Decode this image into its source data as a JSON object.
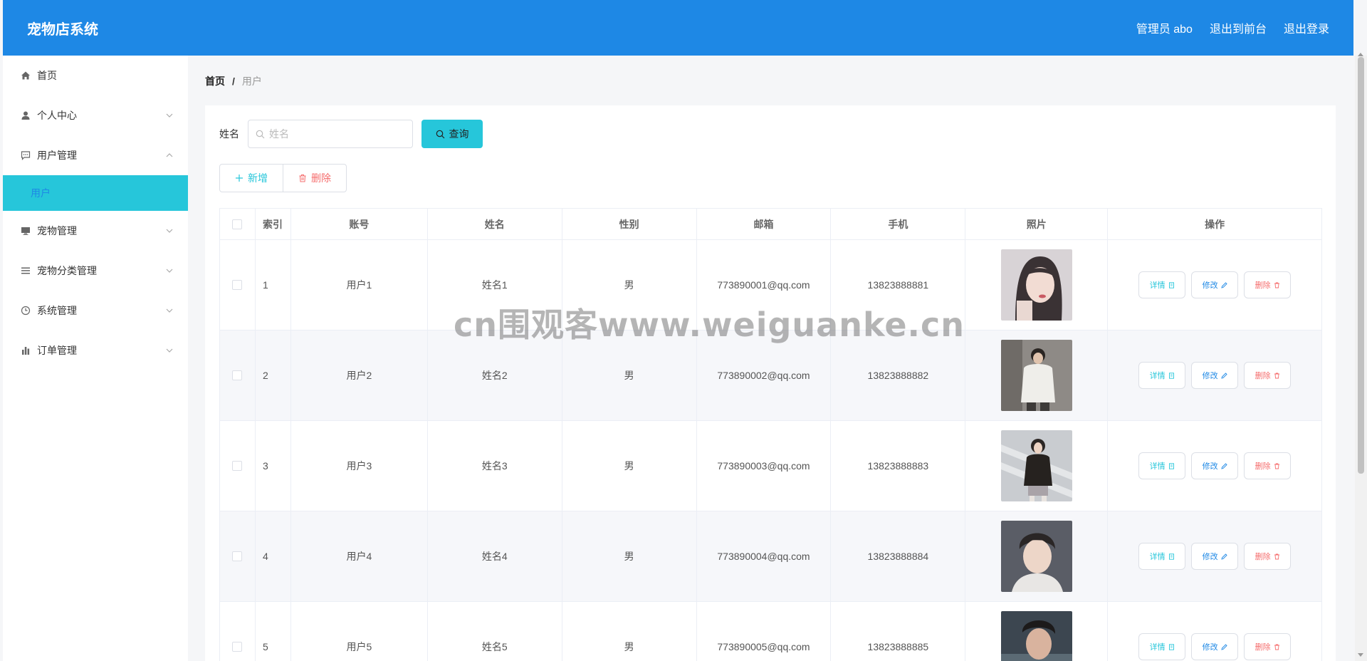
{
  "header": {
    "brand": "宠物店系统",
    "user_label": "管理员 abo",
    "back_to_front": "退出到前台",
    "logout": "退出登录",
    "bg_color": "#1e88e5"
  },
  "sidebar": {
    "items": [
      {
        "label": "首页",
        "icon": "home-icon",
        "expandable": false
      },
      {
        "label": "个人中心",
        "icon": "user-icon",
        "expandable": true,
        "expanded": false
      },
      {
        "label": "用户管理",
        "icon": "chat-icon",
        "expandable": true,
        "expanded": true
      },
      {
        "label": "宠物管理",
        "icon": "monitor-icon",
        "expandable": true,
        "expanded": false
      },
      {
        "label": "宠物分类管理",
        "icon": "list-icon",
        "expandable": true,
        "expanded": false
      },
      {
        "label": "系统管理",
        "icon": "clock-icon",
        "expandable": true,
        "expanded": false
      },
      {
        "label": "订单管理",
        "icon": "bar-chart-icon",
        "expandable": true,
        "expanded": false
      }
    ],
    "active_sub_item": "用户",
    "active_color": "#26c6da"
  },
  "breadcrumb": {
    "home": "首页",
    "separator": "/",
    "current": "用户"
  },
  "search": {
    "label": "姓名",
    "placeholder": "姓名",
    "value": "",
    "button_label": "查询"
  },
  "actions": {
    "add_label": "新增",
    "delete_label": "删除"
  },
  "table": {
    "columns": [
      "索引",
      "账号",
      "姓名",
      "性别",
      "邮箱",
      "手机",
      "照片",
      "操作"
    ],
    "rows": [
      {
        "index": "1",
        "account": "用户1",
        "name": "姓名1",
        "sex": "男",
        "email": "773890001@qq.com",
        "phone": "13823888881",
        "photo": "photo-portrait-1-icon"
      },
      {
        "index": "2",
        "account": "用户2",
        "name": "姓名2",
        "sex": "男",
        "email": "773890002@qq.com",
        "phone": "13823888882",
        "photo": "photo-portrait-2-icon"
      },
      {
        "index": "3",
        "account": "用户3",
        "name": "姓名3",
        "sex": "男",
        "email": "773890003@qq.com",
        "phone": "13823888883",
        "photo": "photo-portrait-3-icon"
      },
      {
        "index": "4",
        "account": "用户4",
        "name": "姓名4",
        "sex": "男",
        "email": "773890004@qq.com",
        "phone": "13823888884",
        "photo": "photo-portrait-4-icon"
      },
      {
        "index": "5",
        "account": "用户5",
        "name": "姓名5",
        "sex": "男",
        "email": "773890005@qq.com",
        "phone": "13823888885",
        "photo": "photo-portrait-5-icon"
      }
    ],
    "row_actions": {
      "detail": "详情",
      "edit": "修改",
      "delete": "删除"
    }
  },
  "watermark": "cn围观客www.weiguanke.cn"
}
